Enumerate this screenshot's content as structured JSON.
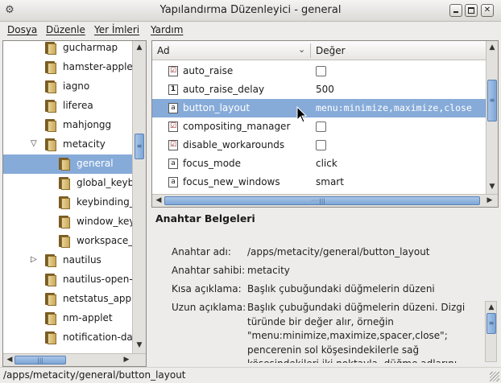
{
  "window": {
    "title": "Yapılandırma Düzenleyici - general",
    "app_icon": "gear-icon"
  },
  "menu": [
    "Dosya",
    "Düzenle",
    "Yer İmleri",
    "Yardım"
  ],
  "tree": {
    "items": [
      {
        "label": "gucharmap",
        "indent": 1,
        "expander": ""
      },
      {
        "label": "hamster-applet",
        "indent": 1,
        "expander": ""
      },
      {
        "label": "iagno",
        "indent": 1,
        "expander": ""
      },
      {
        "label": "liferea",
        "indent": 1,
        "expander": ""
      },
      {
        "label": "mahjongg",
        "indent": 1,
        "expander": ""
      },
      {
        "label": "metacity",
        "indent": 1,
        "expander": "▽"
      },
      {
        "label": "general",
        "indent": 2,
        "expander": "",
        "selected": true
      },
      {
        "label": "global_keybindings",
        "indent": 2,
        "expander": ""
      },
      {
        "label": "keybinding_commands",
        "indent": 2,
        "expander": ""
      },
      {
        "label": "window_keybindings",
        "indent": 2,
        "expander": ""
      },
      {
        "label": "workspace_names",
        "indent": 2,
        "expander": ""
      },
      {
        "label": "nautilus",
        "indent": 1,
        "expander": "▷"
      },
      {
        "label": "nautilus-open-terminal",
        "indent": 1,
        "expander": ""
      },
      {
        "label": "netstatus_applet",
        "indent": 1,
        "expander": ""
      },
      {
        "label": "nm-applet",
        "indent": 1,
        "expander": ""
      },
      {
        "label": "notification-daemon",
        "indent": 1,
        "expander": ""
      }
    ]
  },
  "list": {
    "col_name": "Ad",
    "col_value": "Değer",
    "rows": [
      {
        "name": "auto_raise",
        "type": "bool",
        "type_icon": "check-type-icon",
        "value": "",
        "checked": false
      },
      {
        "name": "auto_raise_delay",
        "type": "int",
        "type_icon": "number-type-icon",
        "type_glyph": "1",
        "value": "500"
      },
      {
        "name": "button_layout",
        "type": "string",
        "type_icon": "string-type-icon",
        "type_glyph": "a",
        "value": "menu:minimize,maximize,close",
        "selected": true
      },
      {
        "name": "compositing_manager",
        "type": "bool",
        "type_icon": "check-type-icon",
        "value": "",
        "checked": false
      },
      {
        "name": "disable_workarounds",
        "type": "bool",
        "type_icon": "check-type-icon",
        "value": "",
        "checked": false
      },
      {
        "name": "focus_mode",
        "type": "string",
        "type_icon": "string-type-icon",
        "type_glyph": "a",
        "value": "click"
      },
      {
        "name": "focus_new_windows",
        "type": "string",
        "type_icon": "string-type-icon",
        "type_glyph": "a",
        "value": "smart"
      }
    ]
  },
  "docs": {
    "title": "Anahtar Belgeleri",
    "key_name_label": "Anahtar adı:",
    "key_name": "/apps/metacity/general/button_layout",
    "owner_label": "Anahtar sahibi:",
    "owner": "metacity",
    "short_label": "Kısa açıklama:",
    "short": "Başlık çubuğundaki düğmelerin düzeni",
    "long_label": "Uzun açıklama:",
    "long": "Başlık çubuğundaki düğmelerin düzeni. Dizgi türünde bir değer alır, örneğin \"menu:minimize,maximize,spacer,close\"; pencerenin sol köşesindekilerle sağ köşesindekileri iki noktayla, düğme adlarını virgülle ayırın. Bir"
  },
  "status": "/apps/metacity/general/button_layout",
  "colors": {
    "selection": "#86abd9",
    "scroll_thumb": "#7ea6d6"
  }
}
